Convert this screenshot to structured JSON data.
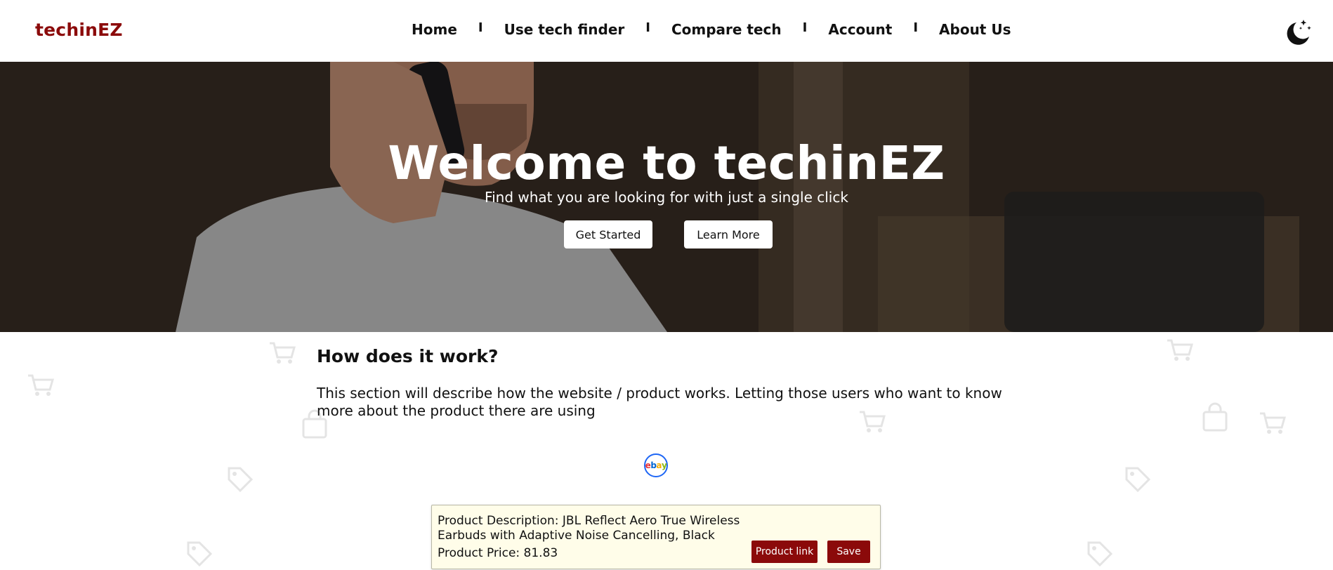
{
  "brand": {
    "name": "techinEZ",
    "color": "#8b0a0a"
  },
  "nav": {
    "items": [
      {
        "label": "Home"
      },
      {
        "label": "Use tech finder"
      },
      {
        "label": "Compare tech"
      },
      {
        "label": "Account"
      },
      {
        "label": "About Us"
      }
    ],
    "separator": "I",
    "theme_icon": "moon-stars-icon"
  },
  "hero": {
    "title": "Welcome to techinEZ",
    "subtitle": "Find what you are looking for with just a single click",
    "get_started_label": "Get Started",
    "learn_more_label": "Learn More"
  },
  "how_it_works": {
    "title": "How does it work?",
    "text": "This section will describe how the website / product works. Letting those users who want to know more about the product there are using"
  },
  "source_logo": {
    "name": "ebay-logo",
    "letters": [
      "e",
      "b",
      "a",
      "y"
    ],
    "colors": [
      "#e53238",
      "#0064d2",
      "#f5af02",
      "#86b817"
    ]
  },
  "product": {
    "description": "Product Description: JBL Reflect Aero True Wireless Earbuds with Adaptive Noise Cancelling, Black",
    "price": "Product Price: 81.83",
    "link_label": "Product link",
    "save_label": "Save"
  }
}
